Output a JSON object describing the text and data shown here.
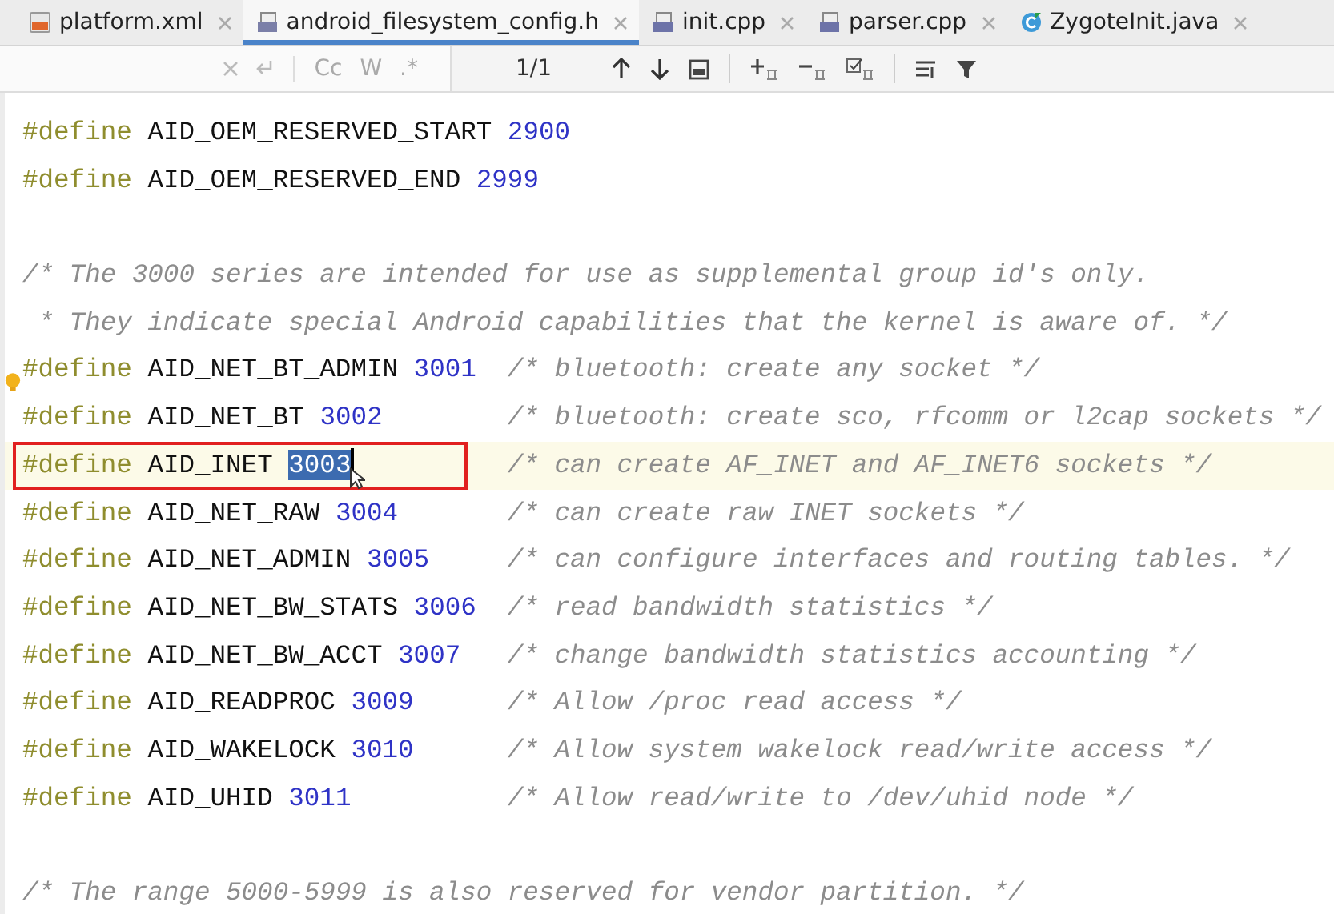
{
  "tabs": [
    {
      "label": "platform.xml",
      "kind": "xml",
      "selected": false
    },
    {
      "label": "android_filesystem_config.h",
      "kind": "header",
      "selected": true
    },
    {
      "label": "init.cpp",
      "kind": "cpp",
      "selected": false
    },
    {
      "label": "parser.cpp",
      "kind": "cpp",
      "selected": false
    },
    {
      "label": "ZygoteInit.java",
      "kind": "java",
      "selected": false
    }
  ],
  "find_bar": {
    "options": [
      "Cc",
      "W",
      ".*"
    ],
    "match_count": "1/1"
  },
  "code_lines": [
    {
      "kind": "define",
      "keyword": "#define",
      "name": "AID_OEM_RESERVED_START",
      "value": "2900",
      "current": false,
      "value_selected": false,
      "boxed": false
    },
    {
      "kind": "define",
      "keyword": "#define",
      "name": "AID_OEM_RESERVED_END",
      "value": "2999",
      "current": false,
      "value_selected": false,
      "boxed": false
    },
    {
      "kind": "blank"
    },
    {
      "kind": "comment",
      "text": "/* The 3000 series are intended for use as supplemental group id's only."
    },
    {
      "kind": "comment",
      "text": " * They indicate special Android capabilities that the kernel is aware of. */"
    },
    {
      "kind": "define",
      "keyword": "#define",
      "name": "AID_NET_BT_ADMIN",
      "value": "3001",
      "comment": "/* bluetooth: create any socket */",
      "current": false,
      "value_selected": false,
      "boxed": false
    },
    {
      "kind": "define",
      "keyword": "#define",
      "name": "AID_NET_BT",
      "value": "3002",
      "comment": "/* bluetooth: create sco, rfcomm or l2cap sockets */",
      "current": false,
      "value_selected": false,
      "boxed": false
    },
    {
      "kind": "define",
      "keyword": "#define",
      "name": "AID_INET",
      "value": "3003",
      "comment": "/* can create AF_INET and AF_INET6 sockets */",
      "current": true,
      "value_selected": true,
      "boxed": true
    },
    {
      "kind": "define",
      "keyword": "#define",
      "name": "AID_NET_RAW",
      "value": "3004",
      "comment": "/* can create raw INET sockets */",
      "current": false,
      "value_selected": false,
      "boxed": false
    },
    {
      "kind": "define",
      "keyword": "#define",
      "name": "AID_NET_ADMIN",
      "value": "3005",
      "comment": "/* can configure interfaces and routing tables. */",
      "current": false,
      "value_selected": false,
      "boxed": false
    },
    {
      "kind": "define",
      "keyword": "#define",
      "name": "AID_NET_BW_STATS",
      "value": "3006",
      "comment": "/* read bandwidth statistics */",
      "current": false,
      "value_selected": false,
      "boxed": false
    },
    {
      "kind": "define",
      "keyword": "#define",
      "name": "AID_NET_BW_ACCT",
      "value": "3007",
      "comment": "/* change bandwidth statistics accounting */",
      "current": false,
      "value_selected": false,
      "boxed": false
    },
    {
      "kind": "define",
      "keyword": "#define",
      "name": "AID_READPROC",
      "value": "3009",
      "comment": "/* Allow /proc read access */",
      "current": false,
      "value_selected": false,
      "boxed": false
    },
    {
      "kind": "define",
      "keyword": "#define",
      "name": "AID_WAKELOCK",
      "value": "3010",
      "comment": "/* Allow system wakelock read/write access */",
      "current": false,
      "value_selected": false,
      "boxed": false
    },
    {
      "kind": "define",
      "keyword": "#define",
      "name": "AID_UHID",
      "value": "3011",
      "comment": "/* Allow read/write to /dev/uhid node */",
      "current": false,
      "value_selected": false,
      "boxed": false
    },
    {
      "kind": "blank"
    },
    {
      "kind": "comment",
      "text": "/* The range 5000-5999 is also reserved for vendor partition. */"
    }
  ]
}
